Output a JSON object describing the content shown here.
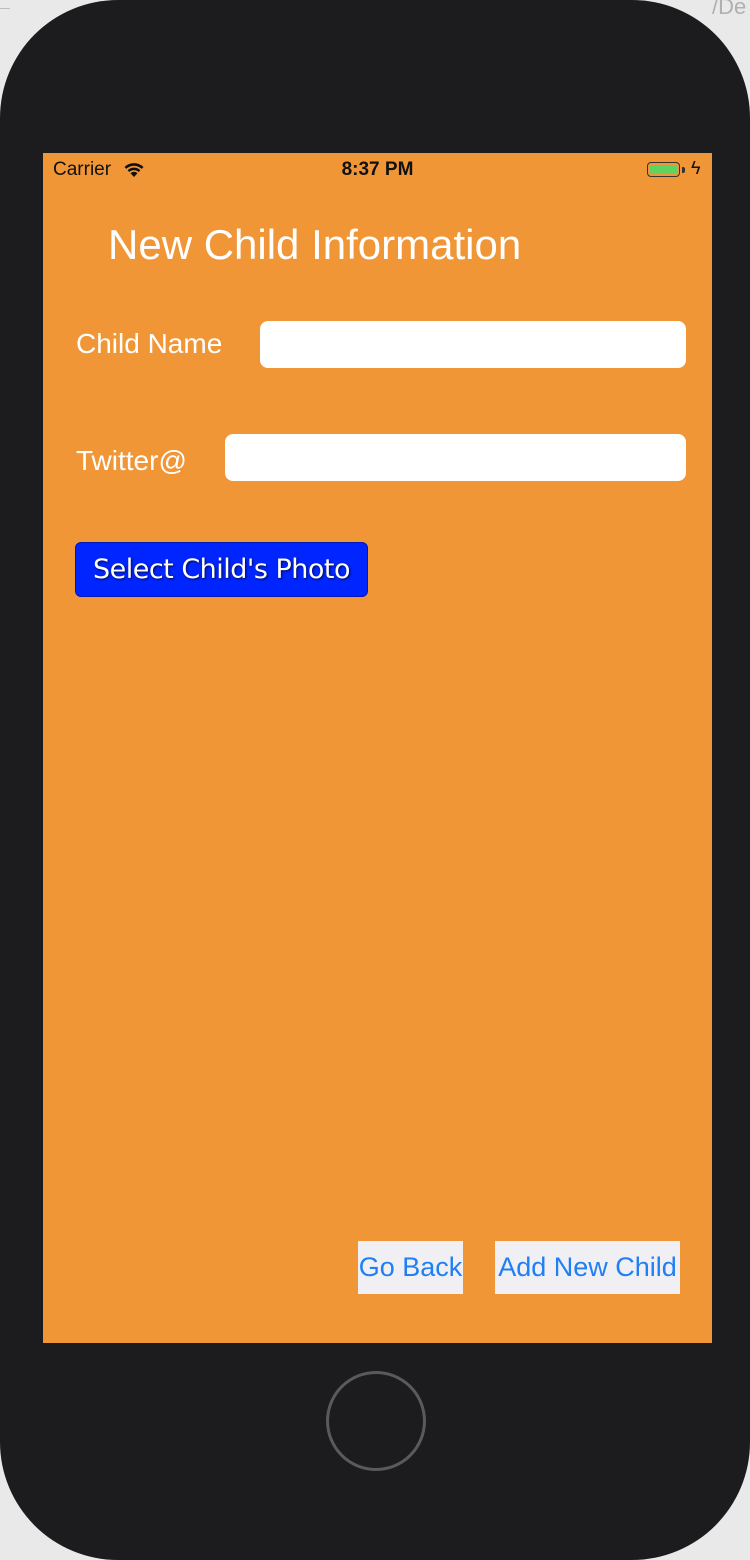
{
  "status_bar": {
    "carrier": "Carrier",
    "time": "8:37 PM",
    "battery_color": "#5fd35f"
  },
  "page_title": "New Child Information",
  "form": {
    "child_name_label": "Child Name",
    "child_name_value": "",
    "twitter_label": "Twitter@",
    "twitter_value": "",
    "select_photo_label": "Select Child's Photo"
  },
  "actions": {
    "go_back_label": "Go Back",
    "add_child_label": "Add New Child"
  },
  "colors": {
    "background": "#f09637",
    "photo_button": "#0025ff",
    "action_text": "#1f7ff5",
    "device": "#1c1c1e"
  },
  "icons": [
    "wifi-icon",
    "battery-icon",
    "charging-bolt-icon",
    "home-button"
  ]
}
